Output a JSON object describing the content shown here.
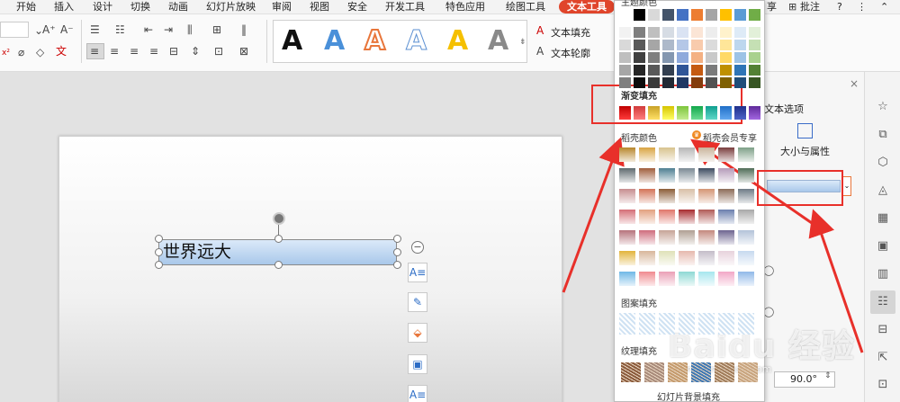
{
  "menu": {
    "items": [
      "开始",
      "插入",
      "设计",
      "切换",
      "动画",
      "幻灯片放映",
      "审阅",
      "视图",
      "安全",
      "开发工具",
      "特色应用",
      "绘图工具"
    ],
    "active": "文本工具",
    "right_items": {
      "share": "享",
      "comment": "批注",
      "help": "?"
    }
  },
  "ribbon": {
    "wordart_letter": "A",
    "text_fill": "文本填充",
    "text_outline": "文本轮廓",
    "font_sizes": [
      "A⁺",
      "A⁻"
    ]
  },
  "slide": {
    "textbox_text": "世界远大"
  },
  "color_picker": {
    "theme_title": "主题颜色",
    "gradient_title": "渐变填充",
    "shell_colors_title": "稻壳颜色",
    "member_label": "稻壳会员专享",
    "pattern_title": "图案填充",
    "texture_title": "纹理填充",
    "slide_bg_fill": "幻灯片背景填充"
  },
  "right_panel": {
    "text_options": "文本选项",
    "size_props": "大小与属性",
    "angle_value": "90.0°"
  },
  "watermark": {
    "text": "Baidu 经验",
    "url": "jingyan.baidu.com"
  },
  "colors": {
    "accent": "#e0452b",
    "annotation_red": "#e8302a"
  }
}
